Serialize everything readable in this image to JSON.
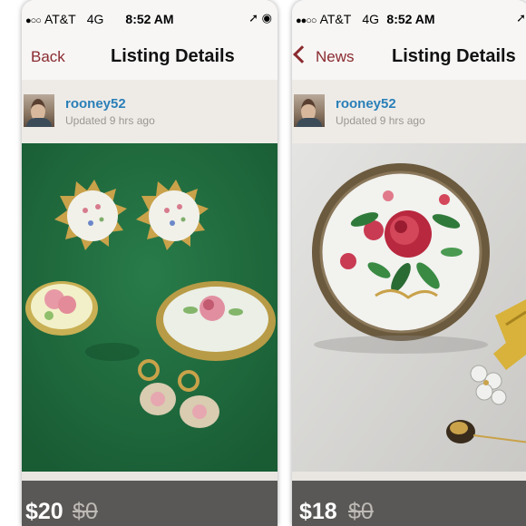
{
  "screens": [
    {
      "status": {
        "carrier": "AT&T",
        "network": "4G",
        "time": "8:52 AM"
      },
      "nav": {
        "back_label": "Back",
        "title": "Listing Details",
        "show_chevron": false
      },
      "seller": {
        "username": "rooney52",
        "updated": "Updated 9 hrs ago"
      },
      "listing": {
        "price": "$20",
        "original_price": "$0"
      }
    },
    {
      "status": {
        "carrier": "AT&T",
        "network": "4G",
        "time": "8:52 AM"
      },
      "nav": {
        "back_label": "News",
        "title": "Listing Details",
        "show_chevron": true
      },
      "seller": {
        "username": "rooney52",
        "updated": "Updated 9 hrs ago"
      },
      "listing": {
        "price": "$18",
        "original_price": "$0"
      }
    }
  ],
  "colors": {
    "nav_accent": "#8a2a2f",
    "username": "#2a7fb8",
    "price_bar": "#5a5856"
  },
  "icons": {
    "signal": "signal-dots-icon",
    "location": "location-arrow-icon",
    "alarm": "alarm-icon",
    "back": "chevron-left-icon"
  }
}
